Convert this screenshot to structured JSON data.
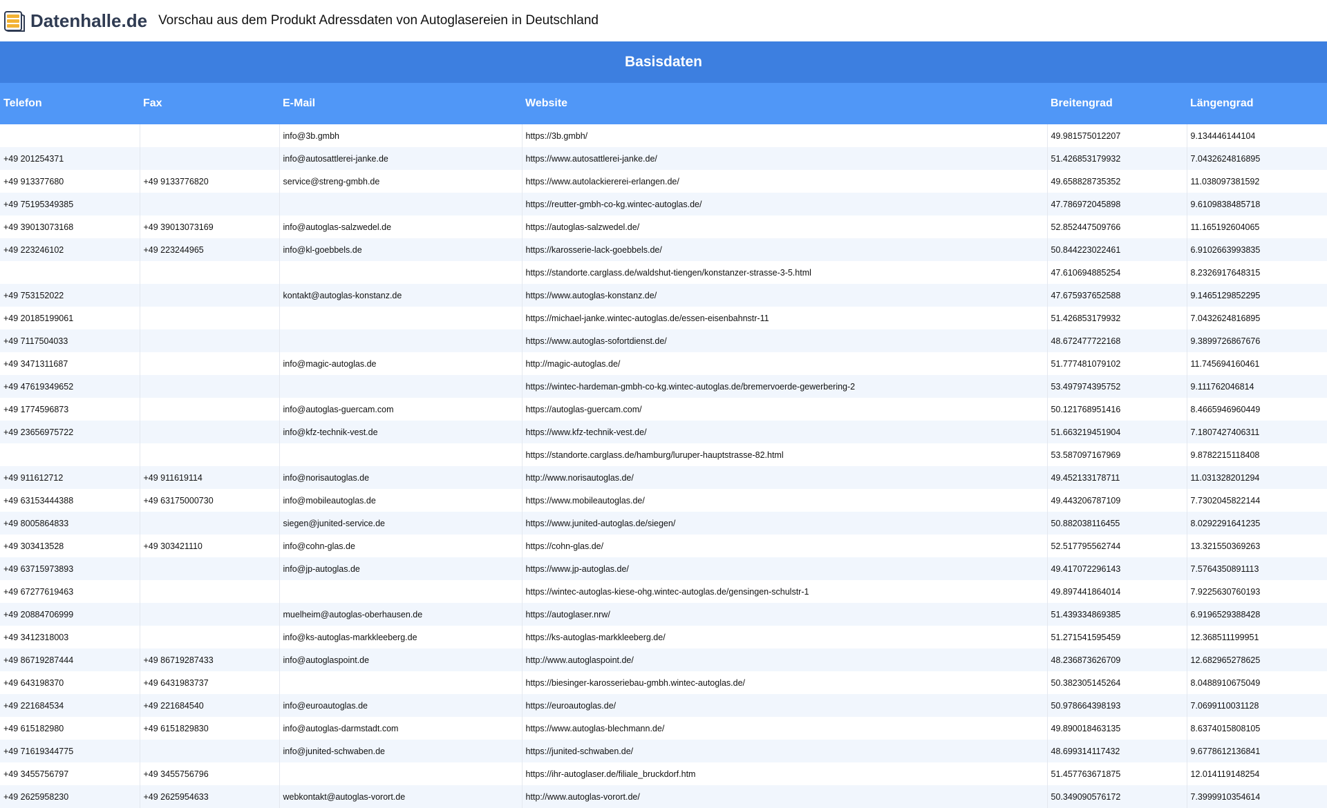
{
  "header": {
    "logo_text": "Datenhalle.de",
    "title": "Vorschau aus dem Produkt Adressdaten von Autoglasereien in Deutschland"
  },
  "colors": {
    "section_header_bg": "#3d7fe0",
    "column_header_bg": "#5097f7",
    "row_alt_bg": "#f1f6fd",
    "logo_text": "#2f3b52",
    "logo_accent": "#f2b233"
  },
  "section": {
    "title": "Basisdaten"
  },
  "table": {
    "columns": [
      "Telefon",
      "Fax",
      "E-Mail",
      "Website",
      "Breitengrad",
      "Längengrad"
    ],
    "rows": [
      [
        "",
        "",
        "info@3b.gmbh",
        "https://3b.gmbh/",
        "49.981575012207",
        "9.134446144104"
      ],
      [
        "+49 201254371",
        "",
        "info@autosattlerei-janke.de",
        "https://www.autosattlerei-janke.de/",
        "51.426853179932",
        "7.0432624816895"
      ],
      [
        "+49 913377680",
        "+49 9133776820",
        "service@streng-gmbh.de",
        "https://www.autolackiererei-erlangen.de/",
        "49.658828735352",
        "11.038097381592"
      ],
      [
        "+49 75195349385",
        "",
        "",
        "https://reutter-gmbh-co-kg.wintec-autoglas.de/",
        "47.786972045898",
        "9.6109838485718"
      ],
      [
        "+49 39013073168",
        "+49 39013073169",
        "info@autoglas-salzwedel.de",
        "https://autoglas-salzwedel.de/",
        "52.852447509766",
        "11.165192604065"
      ],
      [
        "+49 223246102",
        "+49 223244965",
        "info@kl-goebbels.de",
        "https://karosserie-lack-goebbels.de/",
        "50.844223022461",
        "6.9102663993835"
      ],
      [
        "",
        "",
        "",
        "https://standorte.carglass.de/waldshut-tiengen/konstanzer-strasse-3-5.html",
        "47.610694885254",
        "8.2326917648315"
      ],
      [
        "+49 753152022",
        "",
        "kontakt@autoglas-konstanz.de",
        "https://www.autoglas-konstanz.de/",
        "47.675937652588",
        "9.1465129852295"
      ],
      [
        "+49 20185199061",
        "",
        "",
        "https://michael-janke.wintec-autoglas.de/essen-eisenbahnstr-11",
        "51.426853179932",
        "7.0432624816895"
      ],
      [
        "+49 7117504033",
        "",
        "",
        "https://www.autoglas-sofortdienst.de/",
        "48.672477722168",
        "9.3899726867676"
      ],
      [
        "+49 3471311687",
        "",
        "info@magic-autoglas.de",
        "http://magic-autoglas.de/",
        "51.777481079102",
        "11.745694160461"
      ],
      [
        "+49 47619349652",
        "",
        "",
        "https://wintec-hardeman-gmbh-co-kg.wintec-autoglas.de/bremervoerde-gewerbering-2",
        "53.497974395752",
        "9.111762046814"
      ],
      [
        "+49 1774596873",
        "",
        "info@autoglas-guercam.com",
        "https://autoglas-guercam.com/",
        "50.121768951416",
        "8.4665946960449"
      ],
      [
        "+49 23656975722",
        "",
        "info@kfz-technik-vest.de",
        "https://www.kfz-technik-vest.de/",
        "51.663219451904",
        "7.1807427406311"
      ],
      [
        "",
        "",
        "",
        "https://standorte.carglass.de/hamburg/luruper-hauptstrasse-82.html",
        "53.587097167969",
        "9.8782215118408"
      ],
      [
        "+49 911612712",
        "+49 911619114",
        "info@norisautoglas.de",
        "http://www.norisautoglas.de/",
        "49.452133178711",
        "11.031328201294"
      ],
      [
        "+49 63153444388",
        "+49 63175000730",
        "info@mobileautoglas.de",
        "https://www.mobileautoglas.de/",
        "49.443206787109",
        "7.7302045822144"
      ],
      [
        "+49 8005864833",
        "",
        "siegen@junited-service.de",
        "https://www.junited-autoglas.de/siegen/",
        "50.882038116455",
        "8.0292291641235"
      ],
      [
        "+49 303413528",
        "+49 303421110",
        "info@cohn-glas.de",
        "https://cohn-glas.de/",
        "52.517795562744",
        "13.321550369263"
      ],
      [
        "+49 63715973893",
        "",
        "info@jp-autoglas.de",
        "https://www.jp-autoglas.de/",
        "49.417072296143",
        "7.5764350891113"
      ],
      [
        "+49 67277619463",
        "",
        "",
        "https://wintec-autoglas-kiese-ohg.wintec-autoglas.de/gensingen-schulstr-1",
        "49.897441864014",
        "7.9225630760193"
      ],
      [
        "+49 20884706999",
        "",
        "muelheim@autoglas-oberhausen.de",
        "https://autoglaser.nrw/",
        "51.439334869385",
        "6.9196529388428"
      ],
      [
        "+49 3412318003",
        "",
        "info@ks-autoglas-markkleeberg.de",
        "https://ks-autoglas-markkleeberg.de/",
        "51.271541595459",
        "12.368511199951"
      ],
      [
        "+49 86719287444",
        "+49 86719287433",
        "info@autoglaspoint.de",
        "http://www.autoglaspoint.de/",
        "48.236873626709",
        "12.682965278625"
      ],
      [
        "+49 643198370",
        "+49 6431983737",
        "",
        "https://biesinger-karosseriebau-gmbh.wintec-autoglas.de/",
        "50.382305145264",
        "8.0488910675049"
      ],
      [
        "+49 221684534",
        "+49 221684540",
        "info@euroautoglas.de",
        "https://euroautoglas.de/",
        "50.978664398193",
        "7.0699110031128"
      ],
      [
        "+49 615182980",
        "+49 6151829830",
        "info@autoglas-darmstadt.com",
        "https://www.autoglas-blechmann.de/",
        "49.890018463135",
        "8.6374015808105"
      ],
      [
        "+49 71619344775",
        "",
        "info@junited-schwaben.de",
        "https://junited-schwaben.de/",
        "48.699314117432",
        "9.6778612136841"
      ],
      [
        "+49 3455756797",
        "+49 3455756796",
        "",
        "https://ihr-autoglaser.de/filiale_bruckdorf.htm",
        "51.457763671875",
        "12.014119148254"
      ],
      [
        "+49 2625958230",
        "+49 2625954633",
        "webkontakt@autoglas-vorort.de",
        "http://www.autoglas-vorort.de/",
        "50.349090576172",
        "7.3999910354614"
      ]
    ]
  }
}
